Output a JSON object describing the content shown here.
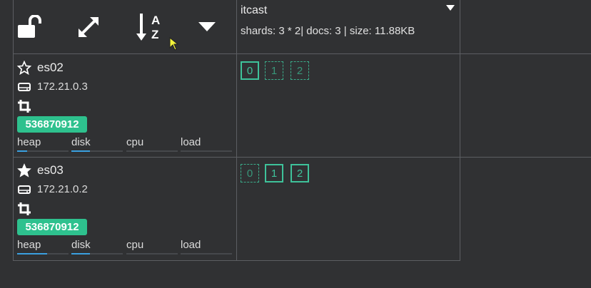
{
  "toolbar": {
    "icons": [
      "unlock-icon",
      "expand-icon",
      "sort-az-icon",
      "caret-down-icon"
    ],
    "sort_letters": [
      "A",
      "Z"
    ]
  },
  "index": {
    "name": "itcast",
    "stats": "shards: 3 * 2| docs: 3 | size: 11.88KB"
  },
  "nodes": [
    {
      "name": "es02",
      "star": "outline",
      "ip": "172.21.0.3",
      "badge": "536870912",
      "metrics": [
        {
          "label": "heap",
          "value": 0.2
        },
        {
          "label": "disk",
          "value": 0.36
        },
        {
          "label": "cpu",
          "value": 0
        },
        {
          "label": "load",
          "value": 0
        }
      ],
      "shards": [
        {
          "label": "0",
          "primary": true
        },
        {
          "label": "1",
          "primary": false
        },
        {
          "label": "2",
          "primary": false
        }
      ]
    },
    {
      "name": "es03",
      "star": "filled",
      "ip": "172.21.0.2",
      "badge": "536870912",
      "metrics": [
        {
          "label": "heap",
          "value": 0.58
        },
        {
          "label": "disk",
          "value": 0.36
        },
        {
          "label": "cpu",
          "value": 0
        },
        {
          "label": "load",
          "value": 0
        }
      ],
      "shards": [
        {
          "label": "0",
          "primary": false
        },
        {
          "label": "1",
          "primary": true
        },
        {
          "label": "2",
          "primary": true
        }
      ]
    }
  ],
  "colors": {
    "background": "#303133",
    "grid": "#5c5e62",
    "badge": "#2ec18e",
    "shard": "#3ec29a",
    "metric": "#3aa0e0"
  }
}
